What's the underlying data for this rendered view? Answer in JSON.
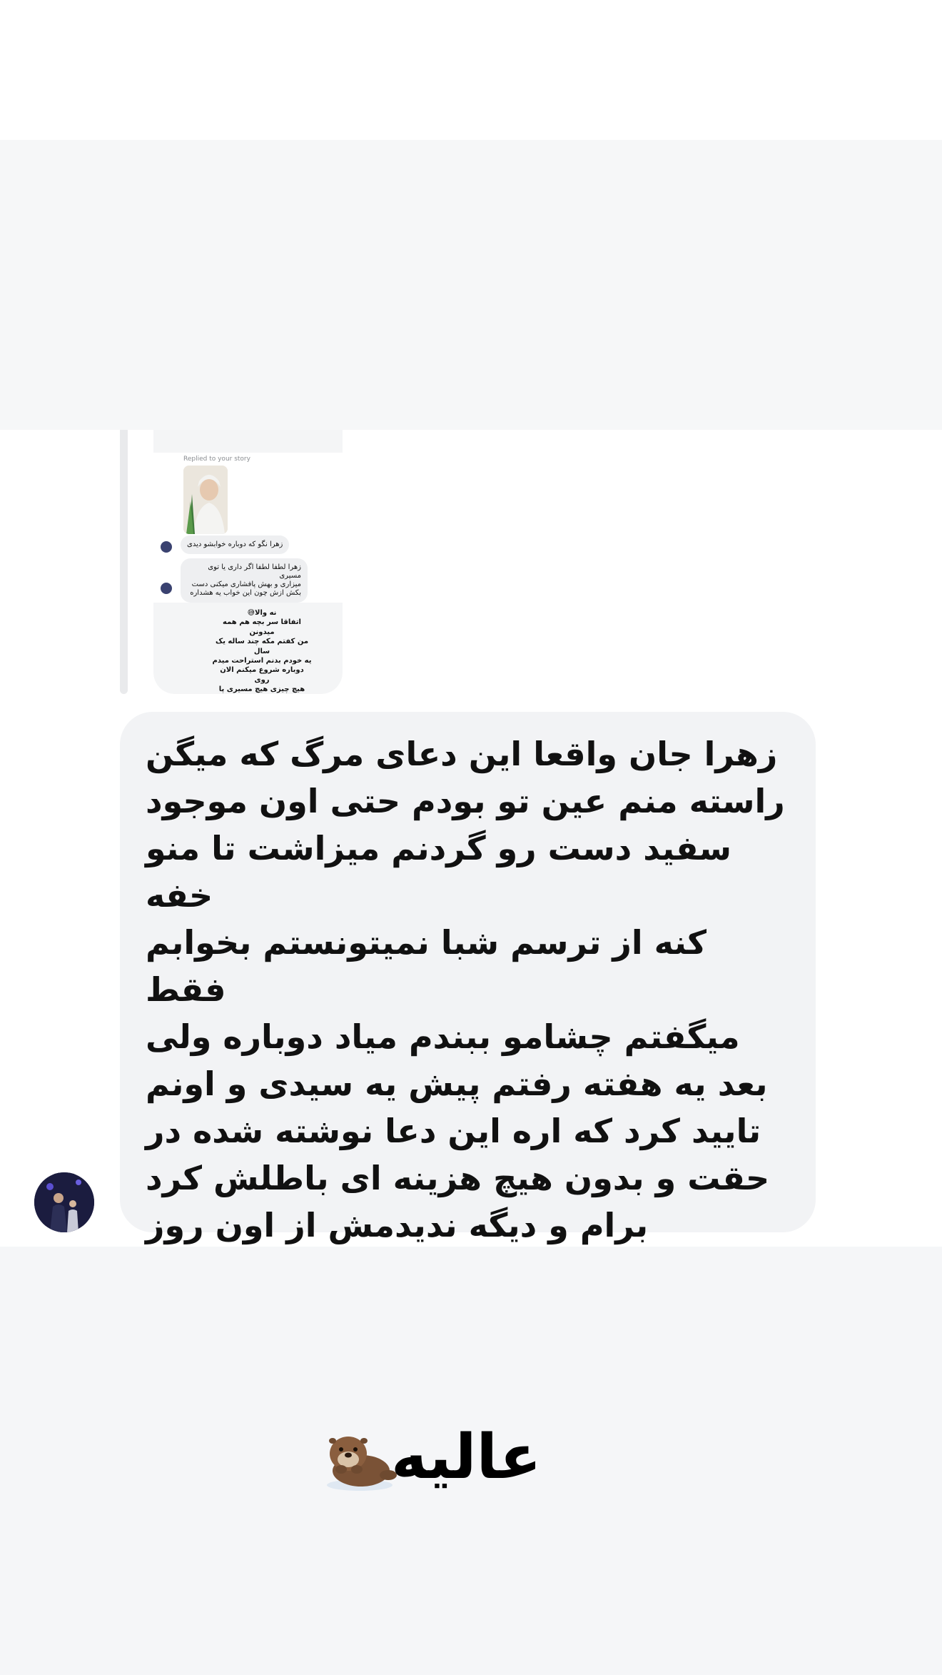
{
  "quoted": {
    "replied_label": "Replied to your story",
    "bubble1": "زهرا نگو که دوباره خوابشو دیدی",
    "bubble2": "زهرا لطفا لطفا اگر داری یا توی مسیری\nمیزاری و بهش پافشاری میکنی دست\nبکش ازش چون این خواب یه هشداره",
    "own_reply": "نه والا😅\nاتفاقا سر بچه هم همه میدونن\nمن کفتم مکه چند ساله یک سال\nیه خودم بدنم استراحت میدم\nدوباره شروع میکنم الان روی\nهیچ چیزی هیچ مسیری پا\nفشاری ندارم😂"
  },
  "message": {
    "text": "زهرا جان واقعا این دعای مرگ که میگن\nراسته منم عین تو بودم حتی اون موجود\nسفید دست رو گردنم میزاشت تا منو خفه\nکنه از ترسم شبا نمیتونستم بخوابم فقط\nمیگفتم چشامو ببندم میاد دوباره ولی\nبعد یه هفته رفتم پیش یه سیدی و اونم\nتایید کرد که اره این دعا نوشته شده در\nحقت و بدون هیچ هزینه ای باطلش کرد\nبرام و دیگه ندیدمش از اون روز\nواقعا وحشتناکه"
  },
  "reaction": {
    "text": "عالیه",
    "emoji": "otter"
  },
  "colors": {
    "bubble": "#f2f3f5",
    "band_gray": "#f6f7f8",
    "avatar_dark": "#1b1c3f"
  }
}
